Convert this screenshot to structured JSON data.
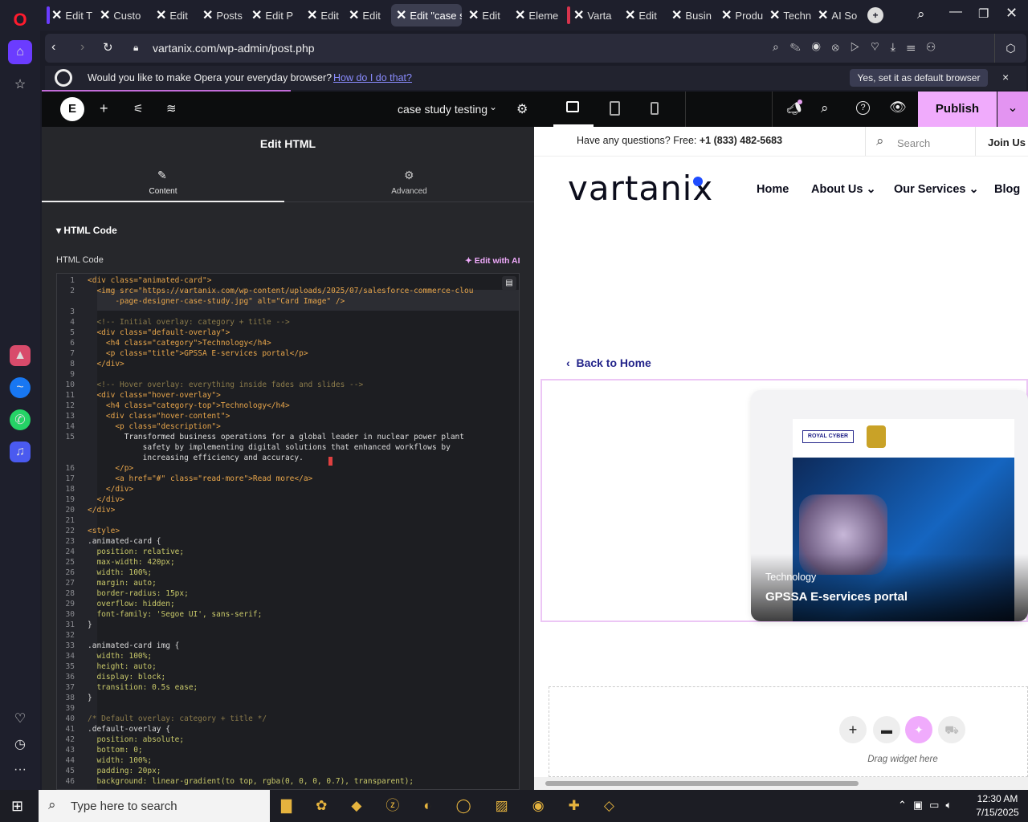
{
  "tabs": [
    {
      "label": "Edit T",
      "active": false
    },
    {
      "label": "Custo",
      "active": false
    },
    {
      "label": "Edit ",
      "active": false
    },
    {
      "label": "Posts",
      "active": false
    },
    {
      "label": "Edit P",
      "active": false
    },
    {
      "label": "Edit ",
      "active": false
    },
    {
      "label": "Edit ",
      "active": false
    },
    {
      "label": "Edit \"case s",
      "active": true
    },
    {
      "label": "Edit ",
      "active": false
    },
    {
      "label": "Eleme",
      "active": false
    },
    {
      "label": "Varta",
      "active": false
    },
    {
      "label": "Edit ",
      "active": false
    },
    {
      "label": "Busin",
      "active": false
    },
    {
      "label": "Produ",
      "active": false
    },
    {
      "label": "Techn",
      "active": false
    },
    {
      "label": "AI So",
      "active": false
    }
  ],
  "address": {
    "url": "vartanix.com/wp-admin/post.php"
  },
  "banner": {
    "question": "Would you like to make Opera your everyday browser?",
    "link": "How do I do that?",
    "action": "Yes, set it as default browser",
    "close": "×"
  },
  "editor": {
    "doc_title": "case study testing",
    "publish": "Publish",
    "panel_title": "Edit HTML",
    "tab_content": "Content",
    "tab_advanced": "Advanced",
    "section": "HTML Code",
    "field_label": "HTML Code",
    "ai_button": "Edit with AI"
  },
  "code_lines": [
    {
      "n": "1",
      "t": "<div class=\"animated-card\">",
      "c": "#e8a64b"
    },
    {
      "n": "2",
      "t": "  <img src=\"https://vartanix.com/wp-content/uploads/2025/07/salesforce-commerce-clou",
      "c": "#e8a64b"
    },
    {
      "n": "",
      "t": "      -page-designer-case-study.jpg\" alt=\"Card Image\" />",
      "c": "#e8a64b"
    },
    {
      "n": "3",
      "t": "",
      "c": "#ccc"
    },
    {
      "n": "4",
      "t": "  <!-- Initial overlay: category + title -->",
      "c": "#8a7a4a"
    },
    {
      "n": "5",
      "t": "  <div class=\"default-overlay\">",
      "c": "#e8a64b"
    },
    {
      "n": "6",
      "t": "    <h4 class=\"category\">Technology</h4>",
      "c": "#e8a64b"
    },
    {
      "n": "7",
      "t": "    <p class=\"title\">GPSSA E-services portal</p>",
      "c": "#e8a64b"
    },
    {
      "n": "8",
      "t": "  </div>",
      "c": "#e8a64b"
    },
    {
      "n": "9",
      "t": "",
      "c": "#ccc"
    },
    {
      "n": "10",
      "t": "  <!-- Hover overlay: everything inside fades and slides -->",
      "c": "#8a7a4a"
    },
    {
      "n": "11",
      "t": "  <div class=\"hover-overlay\">",
      "c": "#e8a64b"
    },
    {
      "n": "12",
      "t": "    <h4 class=\"category-top\">Technology</h4>",
      "c": "#e8a64b"
    },
    {
      "n": "13",
      "t": "    <div class=\"hover-content\">",
      "c": "#e8a64b"
    },
    {
      "n": "14",
      "t": "      <p class=\"description\">",
      "c": "#e8a64b"
    },
    {
      "n": "15",
      "t": "        Transformed business operations for a global leader in nuclear power plant",
      "c": "#dddddd"
    },
    {
      "n": "",
      "t": "            safety by implementing digital solutions that enhanced workflows by",
      "c": "#dddddd"
    },
    {
      "n": "",
      "t": "            increasing efficiency and accuracy.",
      "c": "#dddddd"
    },
    {
      "n": "16",
      "t": "      </p>",
      "c": "#e8a64b"
    },
    {
      "n": "17",
      "t": "      <a href=\"#\" class=\"read-more\">Read more</a>",
      "c": "#e8a64b"
    },
    {
      "n": "18",
      "t": "    </div>",
      "c": "#e8a64b"
    },
    {
      "n": "19",
      "t": "  </div>",
      "c": "#e8a64b"
    },
    {
      "n": "20",
      "t": "</div>",
      "c": "#e8a64b"
    },
    {
      "n": "21",
      "t": "",
      "c": "#ccc"
    },
    {
      "n": "22",
      "t": "<style>",
      "c": "#e8a64b"
    },
    {
      "n": "23",
      "t": ".animated-card {",
      "c": "#dddddd"
    },
    {
      "n": "24",
      "t": "  position: relative;",
      "c": "#c9c96a"
    },
    {
      "n": "25",
      "t": "  max-width: 420px;",
      "c": "#c9c96a"
    },
    {
      "n": "26",
      "t": "  width: 100%;",
      "c": "#c9c96a"
    },
    {
      "n": "27",
      "t": "  margin: auto;",
      "c": "#c9c96a"
    },
    {
      "n": "28",
      "t": "  border-radius: 15px;",
      "c": "#c9c96a"
    },
    {
      "n": "29",
      "t": "  overflow: hidden;",
      "c": "#c9c96a"
    },
    {
      "n": "30",
      "t": "  font-family: 'Segoe UI', sans-serif;",
      "c": "#c9c96a"
    },
    {
      "n": "31",
      "t": "}",
      "c": "#dddddd"
    },
    {
      "n": "32",
      "t": "",
      "c": "#ccc"
    },
    {
      "n": "33",
      "t": ".animated-card img {",
      "c": "#dddddd"
    },
    {
      "n": "34",
      "t": "  width: 100%;",
      "c": "#c9c96a"
    },
    {
      "n": "35",
      "t": "  height: auto;",
      "c": "#c9c96a"
    },
    {
      "n": "36",
      "t": "  display: block;",
      "c": "#c9c96a"
    },
    {
      "n": "37",
      "t": "  transition: 0.5s ease;",
      "c": "#c9c96a"
    },
    {
      "n": "38",
      "t": "}",
      "c": "#dddddd"
    },
    {
      "n": "39",
      "t": "",
      "c": "#ccc"
    },
    {
      "n": "40",
      "t": "/* Default overlay: category + title */",
      "c": "#8a7a4a"
    },
    {
      "n": "41",
      "t": ".default-overlay {",
      "c": "#dddddd"
    },
    {
      "n": "42",
      "t": "  position: absolute;",
      "c": "#c9c96a"
    },
    {
      "n": "43",
      "t": "  bottom: 0;",
      "c": "#c9c96a"
    },
    {
      "n": "44",
      "t": "  width: 100%;",
      "c": "#c9c96a"
    },
    {
      "n": "45",
      "t": "  padding: 20px;",
      "c": "#c9c96a"
    },
    {
      "n": "46",
      "t": "  background: linear-gradient(to top, rgba(0, 0, 0, 0.7), transparent);",
      "c": "#c9c96a"
    }
  ],
  "preview": {
    "question_prefix": "Have any questions? Free:",
    "phone": "+1 (833) 482-5683",
    "search": "Search",
    "join": "Join Us t",
    "logo": "vartanix",
    "nav": [
      "Home",
      "About Us",
      "Our Services",
      "Blog"
    ],
    "back": "Back to Home",
    "card_category": "Technology",
    "card_title": "GPSSA E-services portal",
    "brand": "ROYAL CYBER",
    "drag": "Drag widget here"
  },
  "taskbar": {
    "search": "Type here to search",
    "time": "12:30 AM",
    "date": "7/15/2025"
  }
}
